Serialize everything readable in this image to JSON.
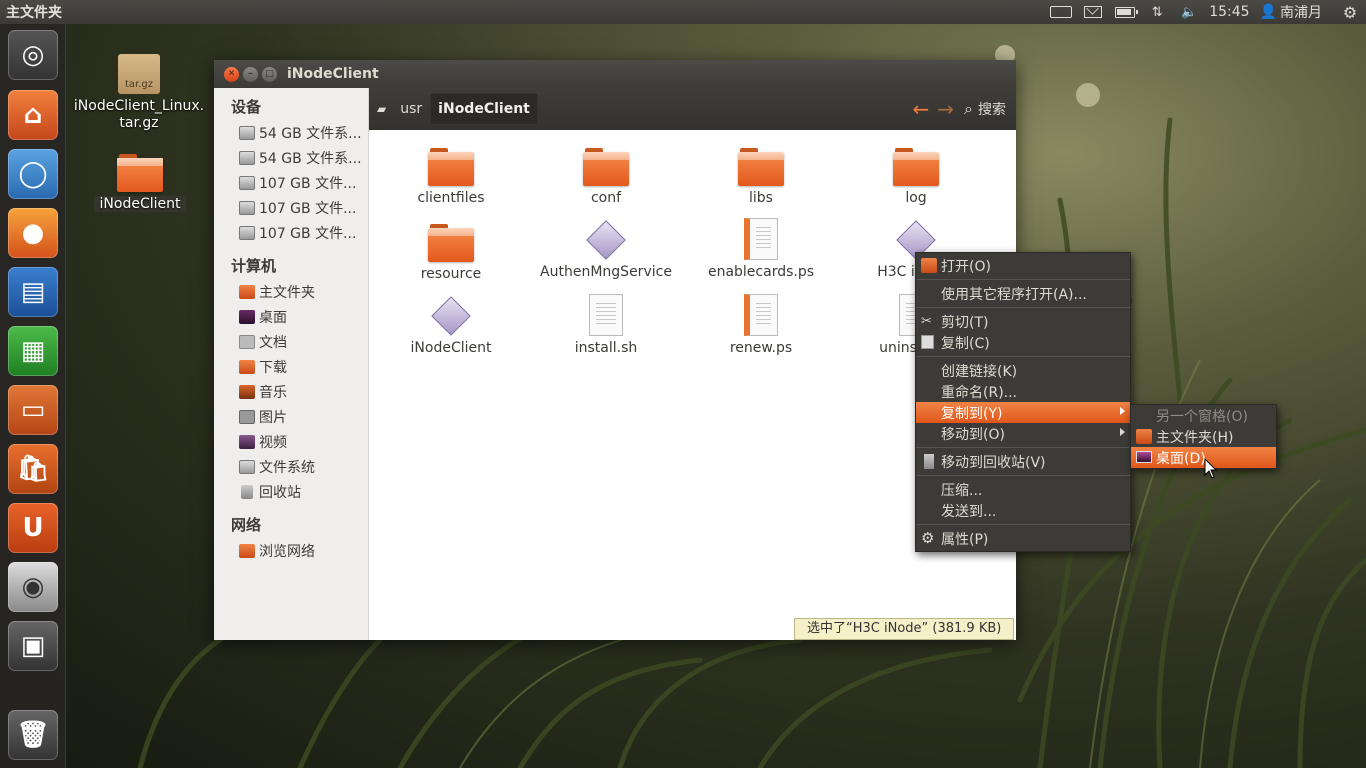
{
  "top_panel": {
    "title": "主文件夹",
    "clock": "15:45",
    "user": "南浦月",
    "indicators": [
      "keyboard-icon",
      "mail-icon",
      "battery-icon",
      "network-icon",
      "volume-icon",
      "power-icon"
    ]
  },
  "launcher": {
    "items": [
      "ubuntu-dash",
      "home-folder",
      "chromium",
      "firefox",
      "libreoffice-writer",
      "libreoffice-calc",
      "libreoffice-impress",
      "ubuntu-software-center",
      "ubuntu-one",
      "camera",
      "workspace-switcher",
      "trash"
    ]
  },
  "desktop": {
    "icons": [
      {
        "label": "iNodeClient_Linux.\ntar.gz",
        "badge": "tar.gz"
      },
      {
        "label": "iNodeClient"
      }
    ]
  },
  "window": {
    "title": "iNodeClient",
    "breadcrumbs": [
      "usr",
      "iNodeClient"
    ],
    "search_label": "搜索",
    "sidebar": {
      "devices_heading": "设备",
      "devices": [
        "54 GB 文件系...",
        "54 GB 文件系...",
        "107 GB 文件...",
        "107 GB 文件...",
        "107 GB 文件..."
      ],
      "computer_heading": "计算机",
      "places": [
        "主文件夹",
        "桌面",
        "文档",
        "下载",
        "音乐",
        "图片",
        "视频",
        "文件系统",
        "回收站"
      ],
      "network_heading": "网络",
      "network": [
        "浏览网络"
      ]
    },
    "files": [
      {
        "name": "clientfiles",
        "type": "folder"
      },
      {
        "name": "conf",
        "type": "folder"
      },
      {
        "name": "libs",
        "type": "folder"
      },
      {
        "name": "log",
        "type": "folder"
      },
      {
        "name": "resource",
        "type": "folder"
      },
      {
        "name": "AuthenMngService",
        "type": "exec"
      },
      {
        "name": "enablecards.ps",
        "type": "ps"
      },
      {
        "name": "H3C i",
        "type": "exec"
      },
      {
        "name": "iNodeClient",
        "type": "exec"
      },
      {
        "name": "install.sh",
        "type": "script"
      },
      {
        "name": "renew.ps",
        "type": "ps"
      },
      {
        "name": "unins",
        "type": "script"
      }
    ],
    "status": "选中了“H3C iNode” (381.9 KB)"
  },
  "context_menu": {
    "items": [
      "打开(O)",
      "使用其它程序打开(A)...",
      "剪切(T)",
      "复制(C)",
      "创建链接(K)",
      "重命名(R)...",
      "复制到(Y)",
      "移动到(O)",
      "移动到回收站(V)",
      "压缩...",
      "发送到...",
      "属性(P)"
    ]
  },
  "submenu": {
    "items": [
      "另一个窗格(O)",
      "主文件夹(H)",
      "桌面(D)"
    ]
  },
  "colors": {
    "accent": "#e95420",
    "panel": "#3c3b37"
  }
}
